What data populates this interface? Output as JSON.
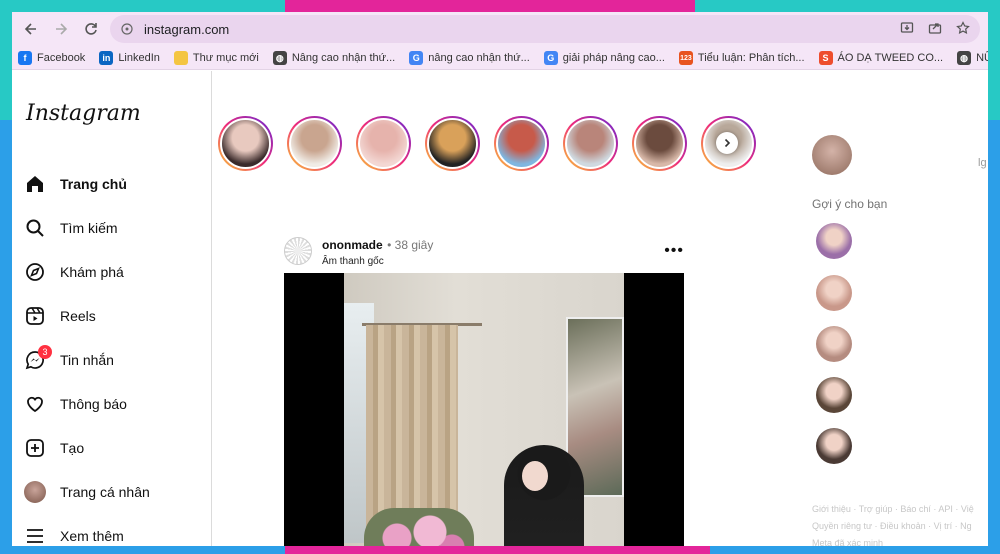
{
  "browser": {
    "url": "instagram.com",
    "bookmarks": [
      {
        "label": "Facebook",
        "icon": "facebook-icon",
        "color": "#1877f2",
        "glyph": "f"
      },
      {
        "label": "LinkedIn",
        "icon": "linkedin-icon",
        "color": "#0a66c2",
        "glyph": "in"
      },
      {
        "label": "Thư mục mới",
        "icon": "folder-icon",
        "color": "#f4c542",
        "glyph": ""
      },
      {
        "label": "Nâng cao nhận thứ...",
        "icon": "globe-icon",
        "color": "#444444",
        "glyph": "◍"
      },
      {
        "label": "nâng cao nhận thứ...",
        "icon": "google-icon",
        "color": "#4285f4",
        "glyph": "G"
      },
      {
        "label": "giải pháp nâng cao...",
        "icon": "google-icon",
        "color": "#4285f4",
        "glyph": "G"
      },
      {
        "label": "Tiểu luận: Phân tích...",
        "icon": "123doc-icon",
        "color": "#e8531f",
        "glyph": "123"
      },
      {
        "label": "ÁO DẠ TWEED CO...",
        "icon": "shopee-icon",
        "color": "#ee4d2d",
        "glyph": "S"
      },
      {
        "label": "NỮ SINH CÙNG...",
        "icon": "globe-icon",
        "color": "#444444",
        "glyph": "◍"
      }
    ]
  },
  "instagram": {
    "logo": "Instagram",
    "nav": [
      {
        "label": "Trang chủ",
        "icon": "home-icon",
        "name": "nav-home",
        "active": true
      },
      {
        "label": "Tìm kiếm",
        "icon": "search-icon",
        "name": "nav-search"
      },
      {
        "label": "Khám phá",
        "icon": "explore-icon",
        "name": "nav-explore"
      },
      {
        "label": "Reels",
        "icon": "reels-icon",
        "name": "nav-reels"
      },
      {
        "label": "Tin nhắn",
        "icon": "messenger-icon",
        "name": "nav-messages",
        "badge": "3"
      },
      {
        "label": "Thông báo",
        "icon": "heart-icon",
        "name": "nav-notifications"
      },
      {
        "label": "Tạo",
        "icon": "create-icon",
        "name": "nav-create"
      },
      {
        "label": "Trang cá nhân",
        "icon": "profile-avatar",
        "name": "nav-profile"
      },
      {
        "label": "Xem thêm",
        "icon": "menu-icon",
        "name": "nav-more"
      }
    ],
    "stories": [
      {
        "colors": [
          "#3a2a2a",
          "#e8c9bf"
        ]
      },
      {
        "colors": [
          "#f0ece6",
          "#c9a58f"
        ]
      },
      {
        "colors": [
          "#f3d7d3",
          "#e6b3ac"
        ]
      },
      {
        "colors": [
          "#222222",
          "#d9a15a"
        ]
      },
      {
        "colors": [
          "#7fb6e0",
          "#c75a4a"
        ]
      },
      {
        "colors": [
          "#cfd9e0",
          "#b9857a"
        ]
      },
      {
        "colors": [
          "#d8b8a8",
          "#6b4b3e"
        ]
      },
      {
        "colors": [
          "#eeeeee",
          "#b8a89a"
        ]
      }
    ],
    "post": {
      "username": "ononmade",
      "time": "• 38 giây",
      "audio": "Âm thanh gốc",
      "more": "•••"
    },
    "right": {
      "suggestions_title": "Gợi ý cho bạn",
      "cut_text": "lg",
      "suggestion_colors": [
        "#9b6fa8",
        "#c9988a",
        "#b58c80",
        "#5a4638",
        "#4a3a34"
      ],
      "footer_lines": [
        "Giới thiệu · Trợ giúp · Báo chí · API · Việ",
        "Quyền riêng tư · Điều khoản · Vị trí · Ng",
        "Meta đã xác minh"
      ]
    }
  }
}
